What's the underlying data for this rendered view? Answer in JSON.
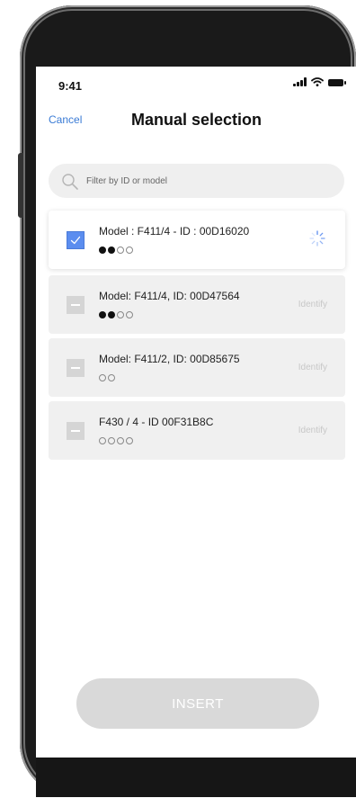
{
  "status_bar": {
    "time": "9:41"
  },
  "header": {
    "cancel_label": "Cancel",
    "title": "Manual selection"
  },
  "search": {
    "placeholder": "Filter by ID or model"
  },
  "devices": [
    {
      "title": "Model : F411/4 - ID : 00D16020",
      "checked": true,
      "dots": [
        "on",
        "on",
        "off",
        "off"
      ],
      "action": "loading-spinner"
    },
    {
      "title": "Model: F411/4, ID: 00D47564",
      "checked": false,
      "dots": [
        "on",
        "on",
        "off",
        "off"
      ],
      "action_label": "Identify"
    },
    {
      "title": "Model: F411/2, ID: 00D85675",
      "checked": false,
      "dots": [
        "off",
        "off"
      ],
      "action_label": "Identify"
    },
    {
      "title": "F430 / 4 - ID 00F31B8C",
      "checked": false,
      "dots": [
        "off",
        "off",
        "off",
        "off"
      ],
      "action_label": "Identify"
    }
  ],
  "footer": {
    "insert_label": "INSERT"
  },
  "colors": {
    "accent": "#3a7bd5",
    "checkbox_checked": "#5b8def",
    "button_disabled": "#d9d9d9"
  }
}
